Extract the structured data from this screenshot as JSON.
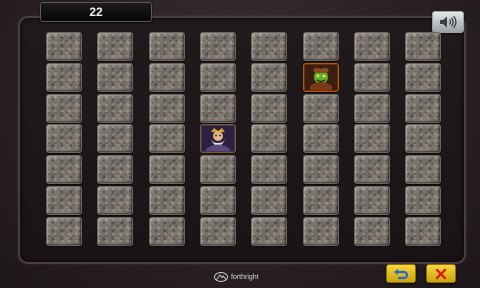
{
  "game": {
    "score": "22",
    "grid": {
      "rows": 7,
      "cols": 8
    },
    "revealed_cards": [
      {
        "row": 1,
        "col": 5,
        "icon": "orc-warrior-icon",
        "frame_color": "#b55a16"
      },
      {
        "row": 3,
        "col": 3,
        "icon": "dwarf-king-icon",
        "frame_color": "#7a5b2a"
      }
    ]
  },
  "footer": {
    "logo_text": "forthright",
    "undo_icon": "undo-arrow-icon",
    "close_icon": "close-x-icon",
    "sound_icon": "speaker-icon"
  },
  "colors": {
    "card_stone": "#7d766e",
    "button_yellow": "#e8c52a",
    "undo_arrow": "#2a67c8",
    "close_x": "#d82020"
  }
}
